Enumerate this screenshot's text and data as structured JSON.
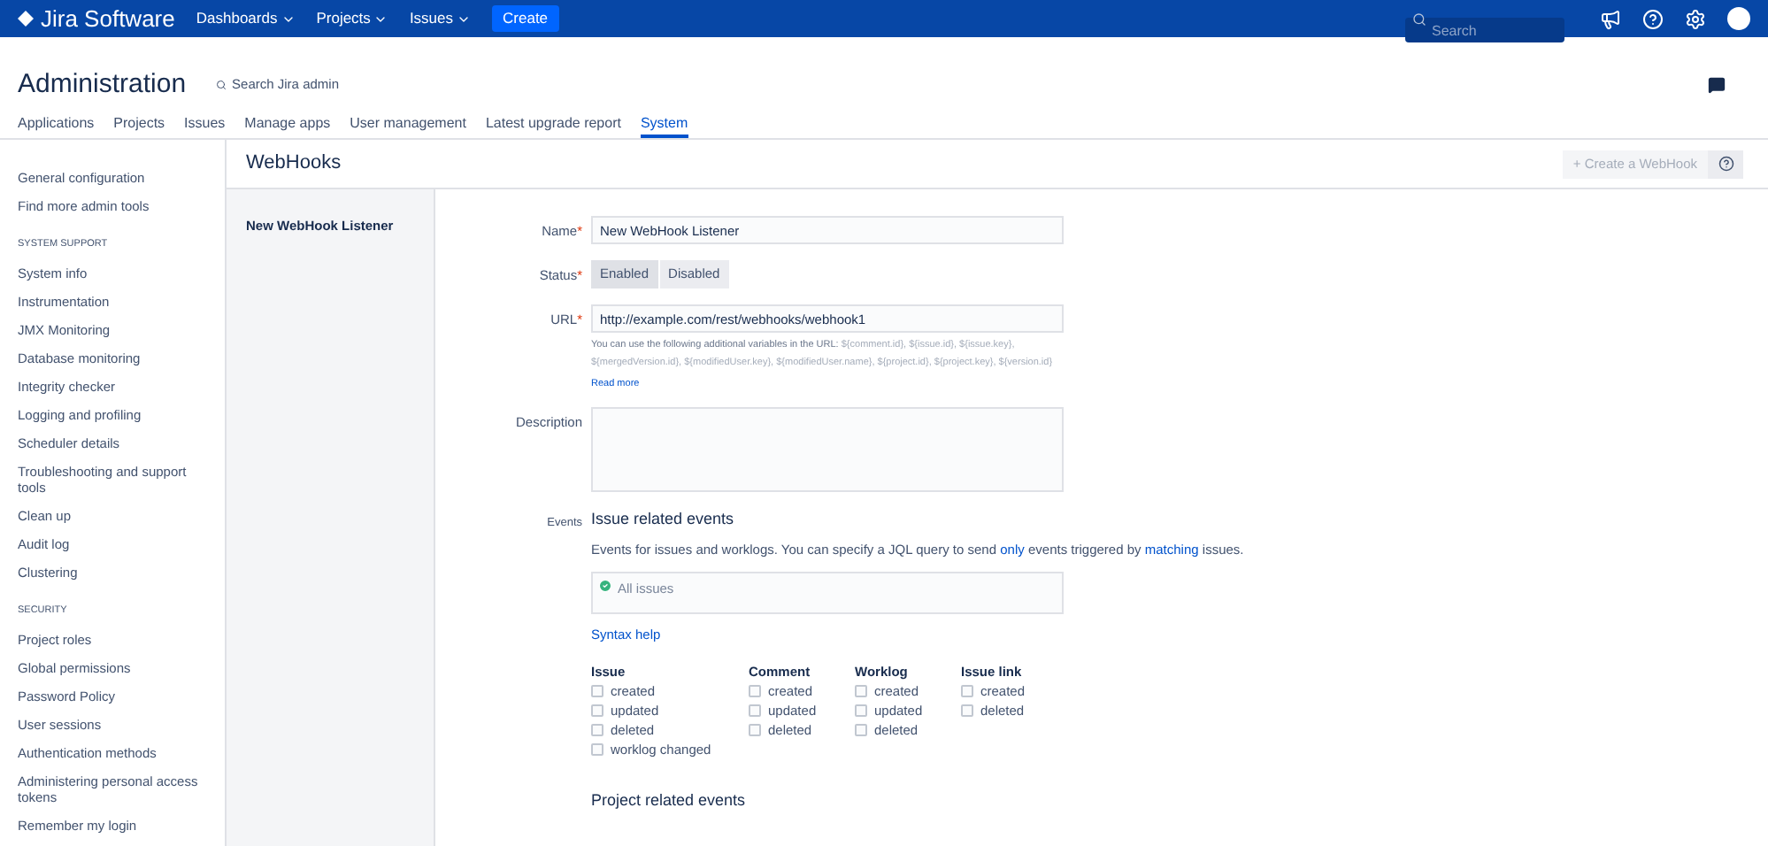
{
  "topbar": {
    "logo": "Jira Software",
    "menus": [
      {
        "label": "Dashboards"
      },
      {
        "label": "Projects"
      },
      {
        "label": "Issues"
      }
    ],
    "create": "Create",
    "search": {
      "placeholder": "Search"
    }
  },
  "header": {
    "title": "Administration",
    "search": "Search Jira admin"
  },
  "tabs": [
    {
      "label": "Applications",
      "selected": false
    },
    {
      "label": "Projects",
      "selected": false
    },
    {
      "label": "Issues",
      "selected": false
    },
    {
      "label": "Manage apps",
      "selected": false
    },
    {
      "label": "User management",
      "selected": false
    },
    {
      "label": "Latest upgrade report",
      "selected": false
    },
    {
      "label": "System",
      "selected": true
    }
  ],
  "sidebar": {
    "sections": [
      {
        "items": [
          "General configuration",
          "Find more admin tools"
        ]
      },
      {
        "heading": "SYSTEM SUPPORT",
        "items": [
          "System info",
          "Instrumentation",
          "JMX Monitoring",
          "Database monitoring",
          "Integrity checker",
          "Logging and profiling",
          "Scheduler details",
          "Troubleshooting and support tools",
          "Clean up",
          "Audit log",
          "Clustering"
        ]
      },
      {
        "heading": "SECURITY",
        "items": [
          "Project roles",
          "Global permissions",
          "Password Policy",
          "User sessions",
          "Authentication methods",
          "Administering personal access tokens",
          "Remember my login"
        ]
      }
    ]
  },
  "page": {
    "title": "WebHooks",
    "create_button": "+ Create a WebHook",
    "listeners": [
      {
        "label": "New WebHook Listener"
      }
    ]
  },
  "form": {
    "name": {
      "label": "Name",
      "required_mark": "*",
      "value": "New WebHook Listener"
    },
    "status": {
      "label": "Status",
      "required_mark": "*",
      "options": [
        {
          "label": "Enabled",
          "selected": true
        },
        {
          "label": "Disabled",
          "selected": false
        }
      ]
    },
    "url": {
      "label": "URL",
      "required_mark": "*",
      "value": "http://example.com/rest/webhooks/webhook1",
      "help": "You can use the following additional variables in the URL:",
      "variables": [
        "${comment.id},",
        "${issue.id},",
        "${issue.key},",
        "${mergedVersion.id},",
        "${modifiedUser.key},",
        "${modifiedUser.name},",
        "${project.id},",
        "${project.key},",
        "${version.id}"
      ],
      "read_more": "Read more"
    },
    "description": {
      "label": "Description"
    },
    "events": {
      "label": "Events",
      "title": "Issue related events",
      "text": [
        {
          "text": "Events for issues and worklogs. You can specify a JQL query to send",
          "link": false
        },
        {
          "text": "only",
          "link": true
        },
        {
          "text": "events triggered by",
          "link": false
        },
        {
          "text": "matching",
          "link": true
        },
        {
          "text": "issues.",
          "link": false
        }
      ],
      "jql": "All issues",
      "syntax_help": "Syntax help",
      "groups": [
        {
          "title": "Issue",
          "options": [
            {
              "label": "created",
              "checked": false
            },
            {
              "label": "updated",
              "checked": false
            },
            {
              "label": "deleted",
              "checked": false
            },
            {
              "label": "worklog changed",
              "checked": false
            }
          ]
        },
        {
          "title": "Comment",
          "options": [
            {
              "label": "created",
              "checked": false
            },
            {
              "label": "updated",
              "checked": false
            },
            {
              "label": "deleted",
              "checked": false
            }
          ]
        },
        {
          "title": "Worklog",
          "options": [
            {
              "label": "created",
              "checked": false
            },
            {
              "label": "updated",
              "checked": false
            },
            {
              "label": "deleted",
              "checked": false
            }
          ]
        },
        {
          "title": "Issue link",
          "options": [
            {
              "label": "created",
              "checked": false
            },
            {
              "label": "deleted",
              "checked": false
            }
          ]
        }
      ],
      "project_title": "Project related events"
    }
  }
}
